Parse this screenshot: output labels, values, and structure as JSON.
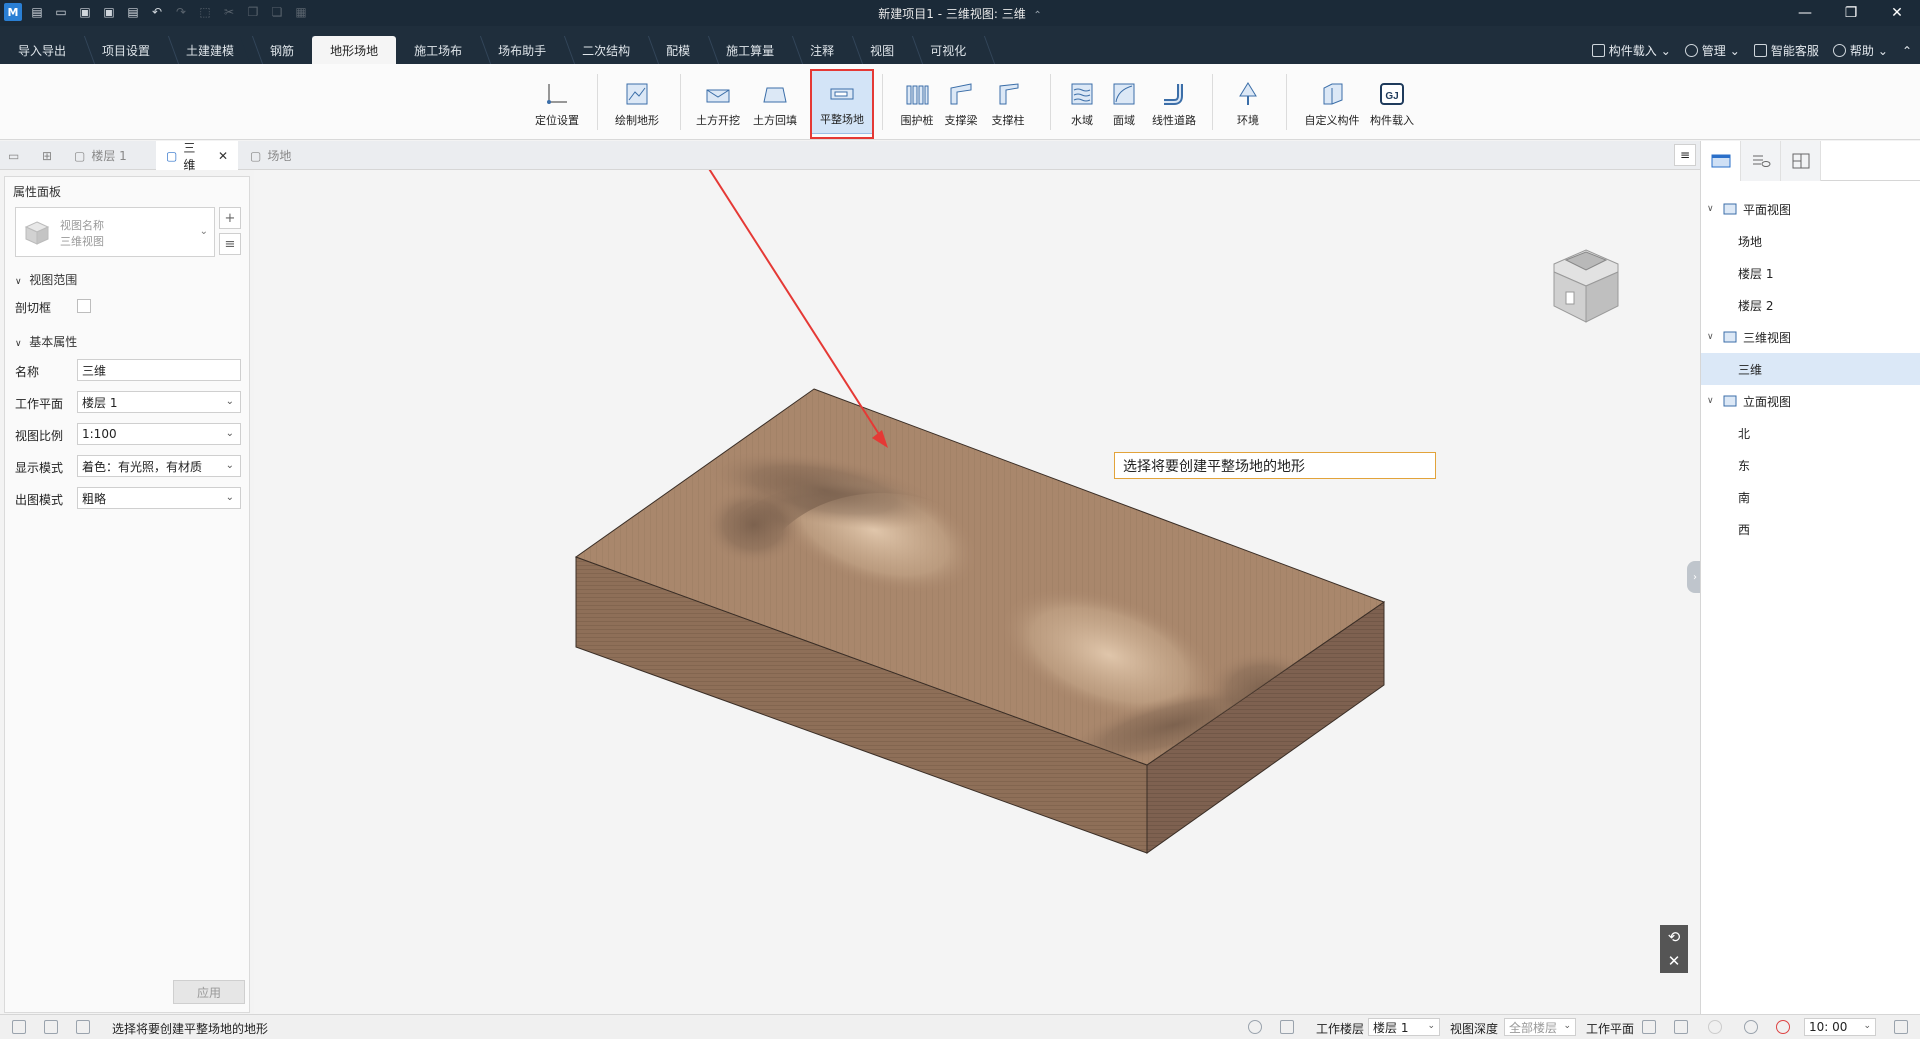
{
  "window": {
    "title": "新建项目1 - 三维视图: 三维",
    "title_caret": "⌃"
  },
  "menu": {
    "tabs": [
      "导入导出",
      "项目设置",
      "土建建模",
      "钢筋",
      "地形场地",
      "施工场布",
      "场布助手",
      "二次结构",
      "配模",
      "施工算量",
      "注释",
      "视图",
      "可视化"
    ],
    "active_index": 4,
    "right": {
      "component_load": "构件载入",
      "manage": "管理",
      "service": "智能客服",
      "help": "帮助"
    }
  },
  "ribbon": {
    "buttons": [
      {
        "label": "定位设置",
        "icon": "axis-locate-icon"
      },
      {
        "label": "绘制地形",
        "icon": "draw-terrain-icon"
      },
      {
        "label": "土方开挖",
        "icon": "earth-excavation-icon"
      },
      {
        "label": "土方回填",
        "icon": "earth-backfill-icon"
      },
      {
        "label": "平整场地",
        "icon": "level-site-icon",
        "selected": true
      },
      {
        "label": "围护桩",
        "icon": "retaining-pile-icon"
      },
      {
        "label": "支撑梁",
        "icon": "support-beam-icon"
      },
      {
        "label": "支撑柱",
        "icon": "support-column-icon"
      },
      {
        "label": "水域",
        "icon": "water-area-icon"
      },
      {
        "label": "面域",
        "icon": "surface-area-icon"
      },
      {
        "label": "线性道路",
        "icon": "linear-road-icon"
      },
      {
        "label": "环境",
        "icon": "tree-environment-icon"
      },
      {
        "label": "自定义构件",
        "icon": "custom-component-icon"
      },
      {
        "label": "构件载入",
        "icon": "gj-load-icon"
      }
    ],
    "highlight_color": "#e53935"
  },
  "doc_tabs": {
    "tabs": [
      {
        "label": "楼层 1",
        "active": false
      },
      {
        "label": "三维",
        "active": true,
        "closable": true
      },
      {
        "label": "场地",
        "active": false
      }
    ],
    "close_glyph": "✕",
    "menu_glyph": "≡"
  },
  "properties": {
    "header": "属性面板",
    "view_name_label": "视图名称",
    "view_name_value": "三维视图",
    "add_glyph": "+",
    "list_glyph": "≡",
    "section_view_range": "视图范围",
    "crop_box_label": "剖切框",
    "section_basic": "基本属性",
    "fields": [
      {
        "label": "名称",
        "value": "三维",
        "dropdown": false
      },
      {
        "label": "工作平面",
        "value": "楼层 1",
        "dropdown": true
      },
      {
        "label": "视图比例",
        "value": "1:100",
        "dropdown": true
      },
      {
        "label": "显示模式",
        "value": "着色：有光照，有材质",
        "dropdown": true
      },
      {
        "label": "出图模式",
        "value": "粗略",
        "dropdown": true
      }
    ],
    "apply_label": "应用"
  },
  "viewport": {
    "callout_text": "选择将要创建平整场地的地形",
    "terrain_color": "#a7856b",
    "arrow_color": "#e53935",
    "nav_rotate_glyph": "⟲",
    "nav_close_glyph": "✕"
  },
  "project_tree": {
    "nodes": [
      {
        "label": "平面视图",
        "level": 0,
        "expanded": true,
        "icon": "plan-view-icon"
      },
      {
        "label": "场地",
        "level": 1
      },
      {
        "label": "楼层 1",
        "level": 1
      },
      {
        "label": "楼层 2",
        "level": 1
      },
      {
        "label": "三维视图",
        "level": 0,
        "expanded": true,
        "icon": "3d-view-icon"
      },
      {
        "label": "三维",
        "level": 1,
        "selected": true
      },
      {
        "label": "立面视图",
        "level": 0,
        "expanded": true,
        "icon": "elevation-view-icon"
      },
      {
        "label": "北",
        "level": 1
      },
      {
        "label": "东",
        "level": 1
      },
      {
        "label": "南",
        "level": 1
      },
      {
        "label": "西",
        "level": 1
      }
    ]
  },
  "status": {
    "message": "选择将要创建平整场地的地形",
    "work_floor_label": "工作楼层",
    "work_floor_value": "楼层 1",
    "view_depth_label": "视图深度",
    "view_depth_value": "全部楼层",
    "work_plane_label": "工作平面",
    "time_value": "10: 00"
  }
}
